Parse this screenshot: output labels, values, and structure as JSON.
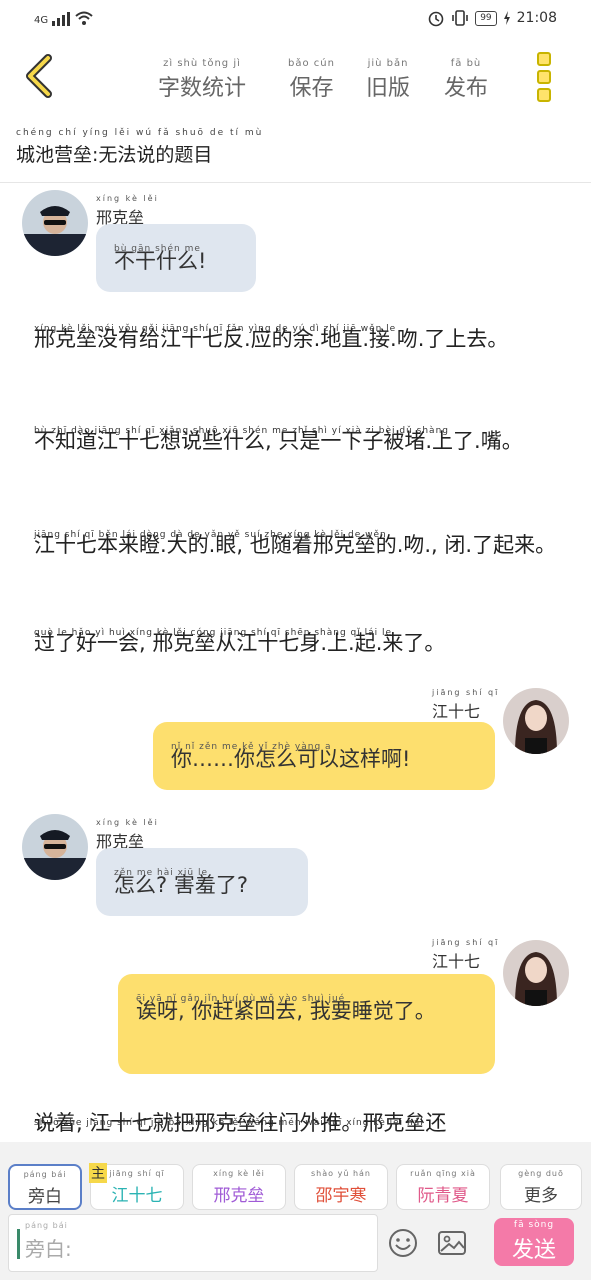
{
  "status": {
    "network": "4G",
    "battery": "99",
    "time": "21:08"
  },
  "toolbar": {
    "word_count": {
      "label": "字数统计",
      "pinyin": "zì shù tǒng jì"
    },
    "save": {
      "label": "保存",
      "pinyin": "bǎo cún"
    },
    "old_version": {
      "label": "旧版",
      "pinyin": "jiù bǎn"
    },
    "publish": {
      "label": "发布",
      "pinyin": "fā bù"
    }
  },
  "doc_title": {
    "text": "城池营垒:无法说的题目",
    "pinyin": "chéng chí yíng lěi  wú fǎ shuō de tí mù"
  },
  "messages": [
    {
      "type": "left",
      "name": "邢克垒",
      "name_pinyin": "xíng kè lěi",
      "text": "不干什么!",
      "pinyin": "bù gān shén me"
    },
    {
      "type": "narration",
      "text": "邢克垒没有给江十七反.应的余.地直.接.吻.了上去。",
      "pinyin": "xíng kè lěi méi yǒu gěi jiāng shí qī fǎn yìng de yú dì zhí jiē wěn le"
    },
    {
      "type": "narration",
      "text": "不知道江十七想说些什么, 只是一下子被堵.上了.嘴。",
      "pinyin": "bù zhī dào jiāng shí qī xiǎng shuō xiē shén me  zhǐ shì yí xià zi bèi dǔ shàng"
    },
    {
      "type": "narration",
      "text": "江十七本来瞪.大的.眼, 也随着邢克垒的.吻., 闭.了起来。",
      "pinyin": "jiāng shí qī běn lái dèng dà de yǎn  yě suí zhe xíng kè lěi de wěn"
    },
    {
      "type": "narration",
      "text": "过了好一会, 邢克垒从江十七身.上.起.来了。",
      "pinyin": "guò le hǎo yì huì  xíng kè lěi cóng jiāng shí qī shēn shàng qǐ lái le"
    },
    {
      "type": "right",
      "name": "江十七",
      "name_pinyin": "jiāng shí qī",
      "text": "你……你怎么可以这样啊!",
      "pinyin": "nǐ      nǐ zěn me kě yǐ zhè yàng a"
    },
    {
      "type": "left",
      "name": "邢克垒",
      "name_pinyin": "xíng kè lěi",
      "text": "怎么? 害羞了?",
      "pinyin": "zěn me   hài xiū le"
    },
    {
      "type": "right",
      "name": "江十七",
      "name_pinyin": "jiāng shí qī",
      "text": "诶呀, 你赶紧回去, 我要睡觉了。",
      "pinyin": "ēi yā  nǐ gǎn jǐn huí qù  wǒ yào shuì jué"
    },
    {
      "type": "narration",
      "text": "说着, 江十七就把邢克垒往门外推。邢克垒还",
      "pinyin": "shuō zhe  jiāng shí qī jiù bǎ xíng kè lěi wǎng mén wài tuī  xíng kè lěi hái"
    }
  ],
  "roles": [
    {
      "label": "旁白",
      "pinyin": "páng bái",
      "color": "#444444",
      "active": true
    },
    {
      "label": "江十七",
      "pinyin": "jiāng shí qī",
      "color": "#2bb3b3",
      "tag": "主"
    },
    {
      "label": "邢克垒",
      "pinyin": "xíng kè lěi",
      "color": "#a05bd6"
    },
    {
      "label": "邵宇寒",
      "pinyin": "shào yǔ hán",
      "color": "#e0503a"
    },
    {
      "label": "阮青夏",
      "pinyin": "ruǎn qīng xià",
      "color": "#e05a8a"
    },
    {
      "label": "更多",
      "pinyin": "gèng duō",
      "color": "#444444"
    }
  ],
  "input": {
    "placeholder": "旁白:",
    "placeholder_pinyin": "páng bái",
    "send_label": "发送",
    "send_pinyin": "fā sòng"
  },
  "colors": {
    "accent_yellow": "#fddf6e",
    "bubble_grey": "#dfe6ef",
    "send_pink": "#f47aa8"
  }
}
